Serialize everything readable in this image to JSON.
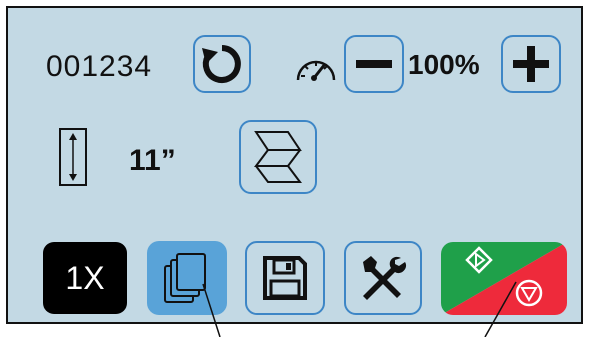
{
  "job": {
    "counter": "001234"
  },
  "speed": {
    "value": "100%"
  },
  "paper": {
    "length": "11”"
  },
  "copies": {
    "label": "1X"
  },
  "icons": {
    "reset": "reset-counter-icon",
    "gauge": "speedometer-icon",
    "minus": "minus-icon",
    "plus": "plus-icon",
    "length": "paper-length-icon",
    "fold": "fold-paper-icon",
    "jobs": "jobs-stack-icon",
    "save": "save-icon",
    "settings": "tools-icon",
    "start": "start-icon",
    "stop": "stop-icon"
  },
  "colors": {
    "screen": "#c3d9e4",
    "button_border": "#3d86c6",
    "active_button": "#59a3d8",
    "start": "#1fa04a",
    "stop": "#ee2a3b",
    "copies_bg": "#000000"
  }
}
